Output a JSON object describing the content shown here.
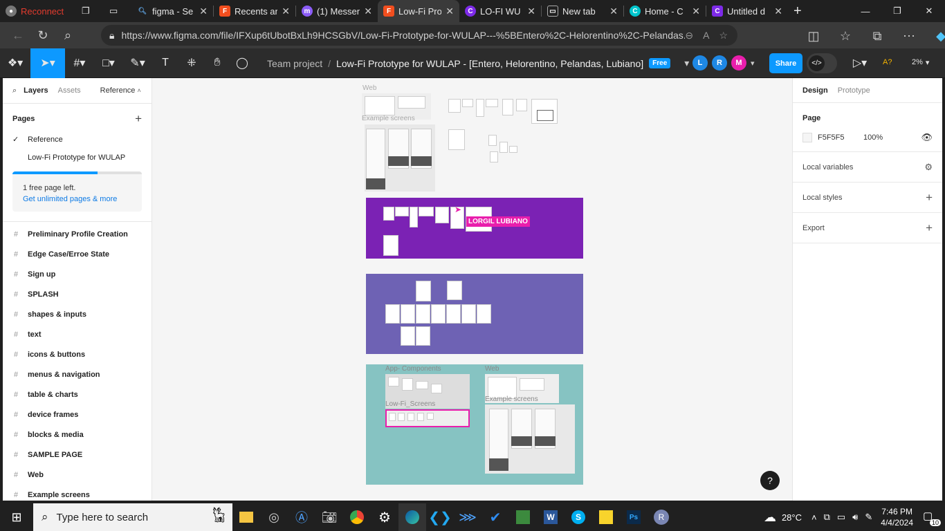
{
  "browser": {
    "tabs": [
      {
        "label": "Reconnect",
        "icon": "profile-icon",
        "color": "#e23b2e"
      },
      {
        "label": "figma - Se",
        "icon": "search-tab-icon",
        "color": "#1a73e8"
      },
      {
        "label": "Recents ar",
        "icon": "figma-icon",
        "color": "#a259ff"
      },
      {
        "label": "(1) Messen",
        "icon": "messenger-icon",
        "color": "#8b5cf6"
      },
      {
        "label": "Low-Fi Pro",
        "icon": "figma-icon",
        "color": "#f24e1e"
      },
      {
        "label": "LO-FI WU",
        "icon": "canva-icon",
        "color": "#7d2ae8"
      },
      {
        "label": "New tab",
        "icon": "newtab-icon",
        "color": "#888888"
      },
      {
        "label": "Home - C",
        "icon": "canva-icon",
        "color": "#00c4cc"
      },
      {
        "label": "Untitled d",
        "icon": "canva-icon",
        "color": "#7d2ae8"
      }
    ],
    "url": "https://www.figma.com/file/IFXup6tUbotBxLh9HCSGbV/Low-Fi-Prototype-for-WULAP---%5BEntero%2C-Helorentino%2C-Pelandas..."
  },
  "figma": {
    "breadcrumb_team": "Team project",
    "separator": "/",
    "file_title": "Low-Fi Prototype for WULAP - [Entero, Helorentino, Pelandas, Lubiano]",
    "plan_badge": "Free",
    "avatars": [
      {
        "letter": "L",
        "color": "#1e88e5"
      },
      {
        "letter": "R",
        "color": "#1e88e5"
      },
      {
        "letter": "M",
        "color": "#e91eac"
      }
    ],
    "share_label": "Share",
    "zoom": "2%",
    "ai_label": "A?"
  },
  "left_panel": {
    "tab_layers": "Layers",
    "tab_assets": "Assets",
    "page_switch": "Reference",
    "pages_title": "Pages",
    "pages": [
      {
        "label": "Reference",
        "active": true
      },
      {
        "label": "Low-Fi Prototype for WULAP",
        "active": false
      }
    ],
    "usage_fraction": 0.66,
    "upgrade_text": "1 free page left.",
    "upgrade_link": "Get unlimited pages & more",
    "layers": [
      "Preliminary Profile Creation",
      "Edge Case/Erroe State",
      "Sign up",
      "SPLASH",
      "shapes & inputs",
      "text",
      "icons & buttons",
      "menus & navigation",
      "table & charts",
      "device frames",
      "blocks & media",
      "SAMPLE PAGE",
      "Web",
      "Example screens"
    ]
  },
  "right_panel": {
    "tab_design": "Design",
    "tab_prototype": "Prototype",
    "page_title": "Page",
    "bg_hex": "F5F5F5",
    "bg_opacity": "100%",
    "local_variables": "Local variables",
    "local_styles": "Local styles",
    "export": "Export"
  },
  "canvas": {
    "label_web": "Web",
    "label_example": "Example screens",
    "cursor_name": "LORGIL LUBIANO",
    "label_app_components": "App- Components",
    "label_lowfi_screens": "Low-Fi_Screens",
    "label_web2": "Web",
    "label_example2": "Example screens",
    "help": "?",
    "colors": {
      "purple": "#7b22b4",
      "lavender": "#6e62b4",
      "teal": "#86c3c2",
      "cursor": "#e91eac"
    }
  },
  "taskbar": {
    "search_placeholder": "Type here to search",
    "temperature": "28°C",
    "time": "7:46 PM",
    "date": "4/4/2024",
    "notifications": "10"
  }
}
